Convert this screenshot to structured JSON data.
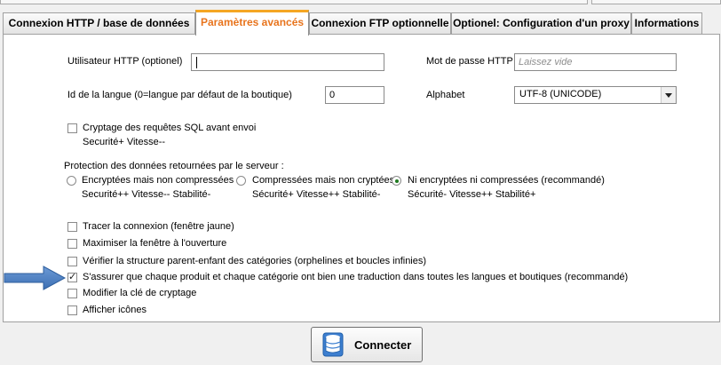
{
  "tabs": [
    {
      "label": "Connexion HTTP / base de données"
    },
    {
      "label": "Paramètres avancés",
      "active": true
    },
    {
      "label": "Connexion FTP optionnelle"
    },
    {
      "label": "Optionel: Configuration d'un proxy"
    },
    {
      "label": "Informations"
    }
  ],
  "accent_color": "#e8741d",
  "form": {
    "http_user_label": "Utilisateur HTTP (optionel)",
    "http_user_value": "",
    "password_label": "Mot de passe HTTP",
    "password_placeholder": "Laissez vide",
    "language_label": "Id de la langue (0=langue par défaut de la boutique)",
    "language_value": "0",
    "alphabet_label": "Alphabet",
    "alphabet_value": "UTF-8 (UNICODE)"
  },
  "encryption": {
    "label": "Cryptage des requêtes SQL avant envoi",
    "sub": "Securité+ Vitesse--",
    "checked": false
  },
  "protection": {
    "title": "Protection des données retournées par le serveur :",
    "options": [
      {
        "label": "Encryptées mais non compressées",
        "sub": "Securité++ Vitesse-- Stabilité-",
        "checked": false
      },
      {
        "label": "Compressées mais non cryptées",
        "sub": "Sécurité+ Vitesse++ Stabilité-",
        "checked": false
      },
      {
        "label": "Ni encryptées ni compressées (recommandé)",
        "sub": "Sécurité- Vitesse++ Stabilité+",
        "checked": true
      }
    ]
  },
  "options": [
    {
      "label": "Tracer la connexion (fenêtre jaune)",
      "checked": false
    },
    {
      "label": "Maximiser la fenêtre à l'ouverture",
      "checked": false
    },
    {
      "label": "Vérifier la structure parent-enfant des catégories (orphelines et boucles infinies)",
      "checked": false
    },
    {
      "label": "S'assurer que chaque produit et chaque catégorie ont bien une traduction dans toutes les langues et boutiques (recommandé)",
      "checked": true
    },
    {
      "label": "Modifier la clé de cryptage",
      "checked": false
    },
    {
      "label": "Afficher icônes",
      "checked": false
    }
  ],
  "connect_button": {
    "label": "Connecter",
    "icon": "database-icon"
  },
  "annotation": {
    "icon": "arrow-right-icon",
    "color": "#4a7fc1"
  }
}
